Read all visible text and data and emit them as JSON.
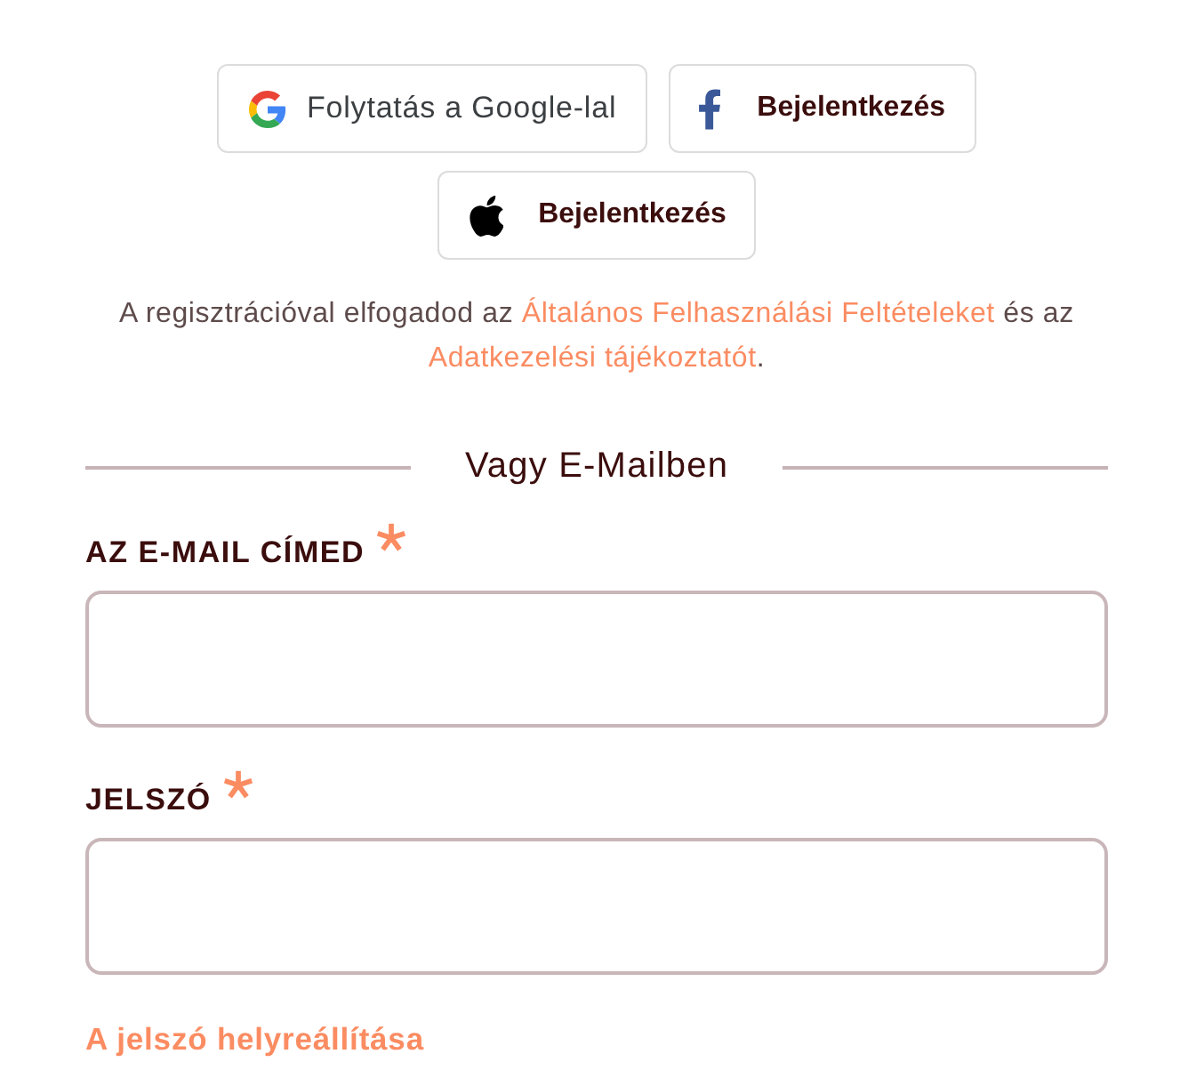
{
  "social_buttons": [
    {
      "kind": "google",
      "label": "Folytatás a Google-lal"
    },
    {
      "kind": "facebook",
      "label": "Bejelentkezés"
    },
    {
      "kind": "apple",
      "label": "Bejelentkezés"
    }
  ],
  "terms": [
    {
      "kind": "text",
      "text": "A regisztrációval elfogadod az "
    },
    {
      "kind": "link",
      "text": "Általános Felhasználási Feltételeket"
    },
    {
      "kind": "text",
      "text": " és az "
    },
    {
      "kind": "link",
      "text": "Adatkezelési tájékoztatót"
    },
    {
      "kind": "text",
      "text": "."
    }
  ],
  "divider": {
    "label": "Vagy E-Mailben"
  },
  "fields": [
    {
      "label": "AZ E-MAIL CÍMED",
      "required": true
    },
    {
      "label": "JELSZÓ",
      "required": true
    }
  ],
  "reset_link": {
    "label": "A jelszó helyreállítása"
  }
}
